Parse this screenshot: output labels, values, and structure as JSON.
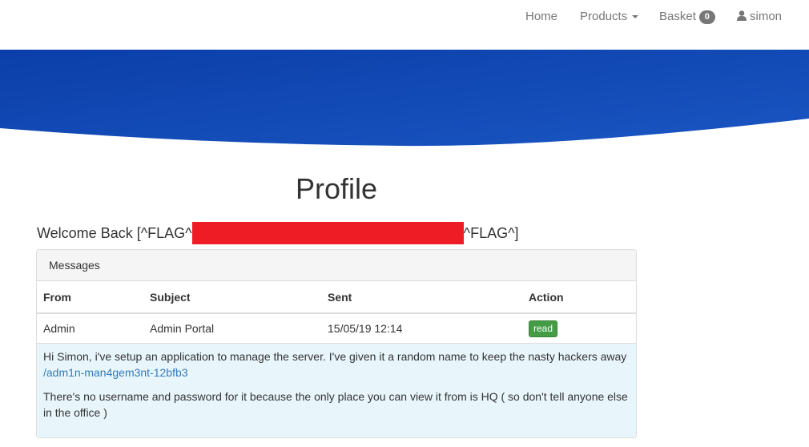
{
  "nav": {
    "home": "Home",
    "products": "Products",
    "basket": "Basket",
    "basket_count": "0",
    "user": "simon"
  },
  "hero": {
    "color_start": "#0b3ea8",
    "color_end": "#1a56c2"
  },
  "page": {
    "title": "Profile",
    "welcome_prefix": "Welcome Back [^FLAG^",
    "welcome_suffix": "^FLAG^]",
    "redaction_color": "#ee1c25"
  },
  "messages": {
    "heading": "Messages",
    "columns": [
      "From",
      "Subject",
      "Sent",
      "Action"
    ],
    "rows": [
      {
        "from": "Admin",
        "subject": "Admin Portal",
        "sent": "15/05/19 12:14",
        "action": "read"
      }
    ],
    "body": {
      "paragraph1": "Hi Simon, i've setup an application to manage the server. I've given it a random name to keep the nasty hackers away",
      "link": "/adm1n-man4gem3nt-12bfb3",
      "paragraph2": "There's no username and password for it because the only place you can view it from is HQ ( so don't tell anyone else in the office )"
    }
  }
}
